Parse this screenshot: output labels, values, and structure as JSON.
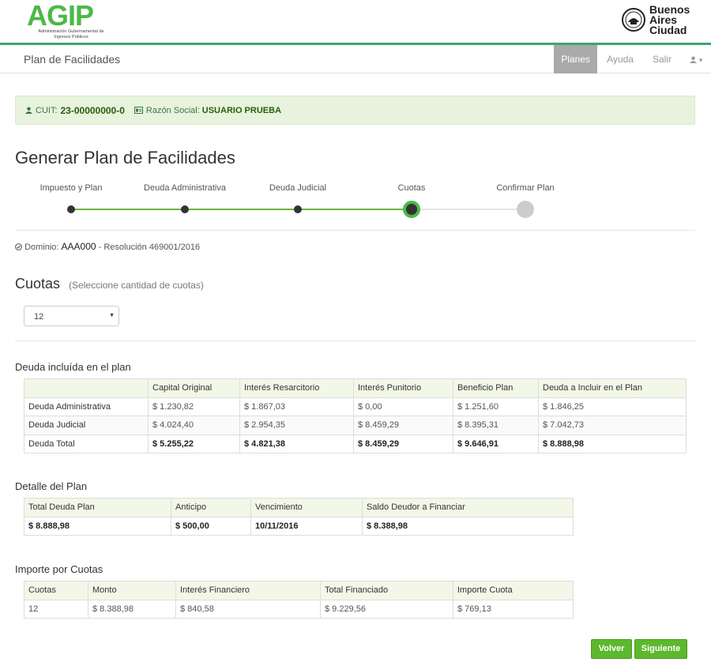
{
  "brand": {
    "agip_word": "AGIP",
    "agip_subtitle": "Administración Gubernamental de Ingresos Públicos",
    "ba_line1": "Buenos",
    "ba_line2": "Aires",
    "ba_line3": "Ciudad"
  },
  "nav": {
    "title": "Plan de Facilidades",
    "items": [
      "Planes",
      "Ayuda",
      "Salir"
    ],
    "user_caret": "▾"
  },
  "alert": {
    "cuit_label": "CUIT:",
    "cuit_value": "23-00000000-0",
    "razon_label": "Razón Social:",
    "razon_value": "USUARIO PRUEBA"
  },
  "page_title": "Generar Plan de Facilidades",
  "steps": [
    "Impuesto y Plan",
    "Deuda Administrativa",
    "Deuda Judicial",
    "Cuotas",
    "Confirmar Plan"
  ],
  "current_step": 4,
  "dominio": {
    "label": "Dominio:",
    "value": "AAA000",
    "resolution": "- Resolución 469001/2016"
  },
  "cuotas_section": {
    "title": "Cuotas",
    "hint": "(Seleccione cantidad de cuotas)",
    "selected": "12"
  },
  "deuda_table": {
    "title": "Deuda incluída en el plan",
    "headers": [
      "",
      "Capital Original",
      "Interés Resarcitorio",
      "Interés Punitorio",
      "Beneficio Plan",
      "Deuda a Incluir en el Plan"
    ],
    "rows": [
      [
        "Deuda Administrativa",
        "$ 1.230,82",
        "$ 1.867,03",
        "$ 0,00",
        "$ 1.251,60",
        "$ 1.846,25"
      ],
      [
        "Deuda Judicial",
        "$ 4.024,40",
        "$ 2.954,35",
        "$ 8.459,29",
        "$ 8.395,31",
        "$ 7.042,73"
      ],
      [
        "Deuda Total",
        "$ 5.255,22",
        "$ 4.821,38",
        "$ 8.459,29",
        "$ 9.646,91",
        "$ 8.888,98"
      ]
    ]
  },
  "detalle_table": {
    "title": "Detalle del Plan",
    "headers": [
      "Total Deuda Plan",
      "Anticipo",
      "Vencimiento",
      "Saldo Deudor a Financiar"
    ],
    "rows": [
      [
        "$ 8.888,98",
        "$ 500,00",
        "10/11/2016",
        "$ 8.388,98"
      ]
    ]
  },
  "importe_table": {
    "title": "Importe por Cuotas",
    "headers": [
      "Cuotas",
      "Monto",
      "Interés Financiero",
      "Total Financiado",
      "Importe Cuota"
    ],
    "rows": [
      [
        "12",
        "$ 8.388,98",
        "$ 840,58",
        "$ 9.229,56",
        "$ 769,13"
      ]
    ]
  },
  "buttons": {
    "back": "Volver",
    "next": "Siguiente"
  },
  "colors": {
    "brand_green": "#4db848",
    "accent_line": "#3aa672",
    "button_green": "#5cb82c"
  }
}
